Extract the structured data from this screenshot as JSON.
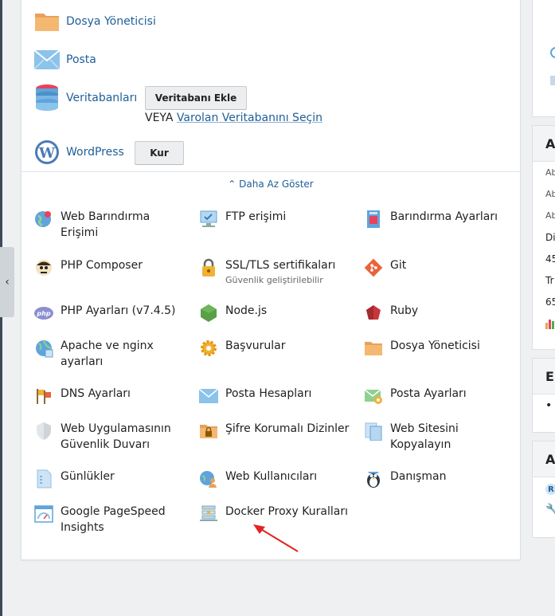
{
  "nav": {
    "collapse_glyph": "‹"
  },
  "quick": {
    "file_manager": "Dosya Yöneticisi",
    "mail": "Posta",
    "databases": "Veritabanları",
    "add_db_button": "Veritabanı Ekle",
    "or_text": "VEYA",
    "select_db_link": "Varolan Veritabanını Seçin",
    "wordpress": "WordPress",
    "install_button": "Kur"
  },
  "toggle": {
    "less_label": "Daha Az Göster",
    "chevron": "^"
  },
  "tools": [
    {
      "label": "Web Barındırma Erişimi",
      "icon": "globe-person-icon"
    },
    {
      "label": "FTP erişimi",
      "icon": "ftp-monitor-icon"
    },
    {
      "label": "Barındırma Ayarları",
      "icon": "hosting-settings-icon"
    },
    {
      "label": "PHP Composer",
      "icon": "composer-icon"
    },
    {
      "label": "SSL/TLS sertifikaları",
      "sub": "Güvenlik geliştirilebilir",
      "icon": "lock-icon"
    },
    {
      "label": "Git",
      "icon": "git-icon"
    },
    {
      "label": "PHP Ayarları (v7.4.5)",
      "icon": "php-icon"
    },
    {
      "label": "Node.js",
      "icon": "nodejs-icon"
    },
    {
      "label": "Ruby",
      "icon": "ruby-icon"
    },
    {
      "label": "Apache ve nginx ayarları",
      "icon": "apache-nginx-icon"
    },
    {
      "label": "Başvurular",
      "icon": "gear-icon"
    },
    {
      "label": "Dosya Yöneticisi",
      "icon": "folder-icon"
    },
    {
      "label": "DNS Ayarları",
      "icon": "dns-flags-icon"
    },
    {
      "label": "Posta Hesapları",
      "icon": "envelope-icon"
    },
    {
      "label": "Posta Ayarları",
      "icon": "mail-settings-icon"
    },
    {
      "label": "Web Uygulamasının Güvenlik Duvarı",
      "icon": "shield-icon"
    },
    {
      "label": "Şifre Korumalı Dizinler",
      "icon": "locked-folder-icon"
    },
    {
      "label": "Web Sitesini Kopyalayın",
      "icon": "copy-site-icon"
    },
    {
      "label": "Günlükler",
      "icon": "log-document-icon"
    },
    {
      "label": "Web Kullanıcıları",
      "icon": "web-users-icon"
    },
    {
      "label": "Danışman",
      "icon": "penguin-advisor-icon"
    },
    {
      "label": "Google PageSpeed Insights",
      "icon": "pagespeed-icon"
    },
    {
      "label": "Docker Proxy Kuralları",
      "icon": "docker-proxy-icon"
    }
  ],
  "sidebar": {
    "card1_title": "A",
    "card1_rows": [
      "Ab",
      "Ab",
      "Ab",
      "Di",
      "45",
      "Tr",
      "65"
    ],
    "card2_title": "E",
    "card2_bullet": "•",
    "card3_title": "A",
    "card3_badge": "R"
  },
  "colors": {
    "link": "#1f5e98",
    "arrow": "#e02424"
  }
}
